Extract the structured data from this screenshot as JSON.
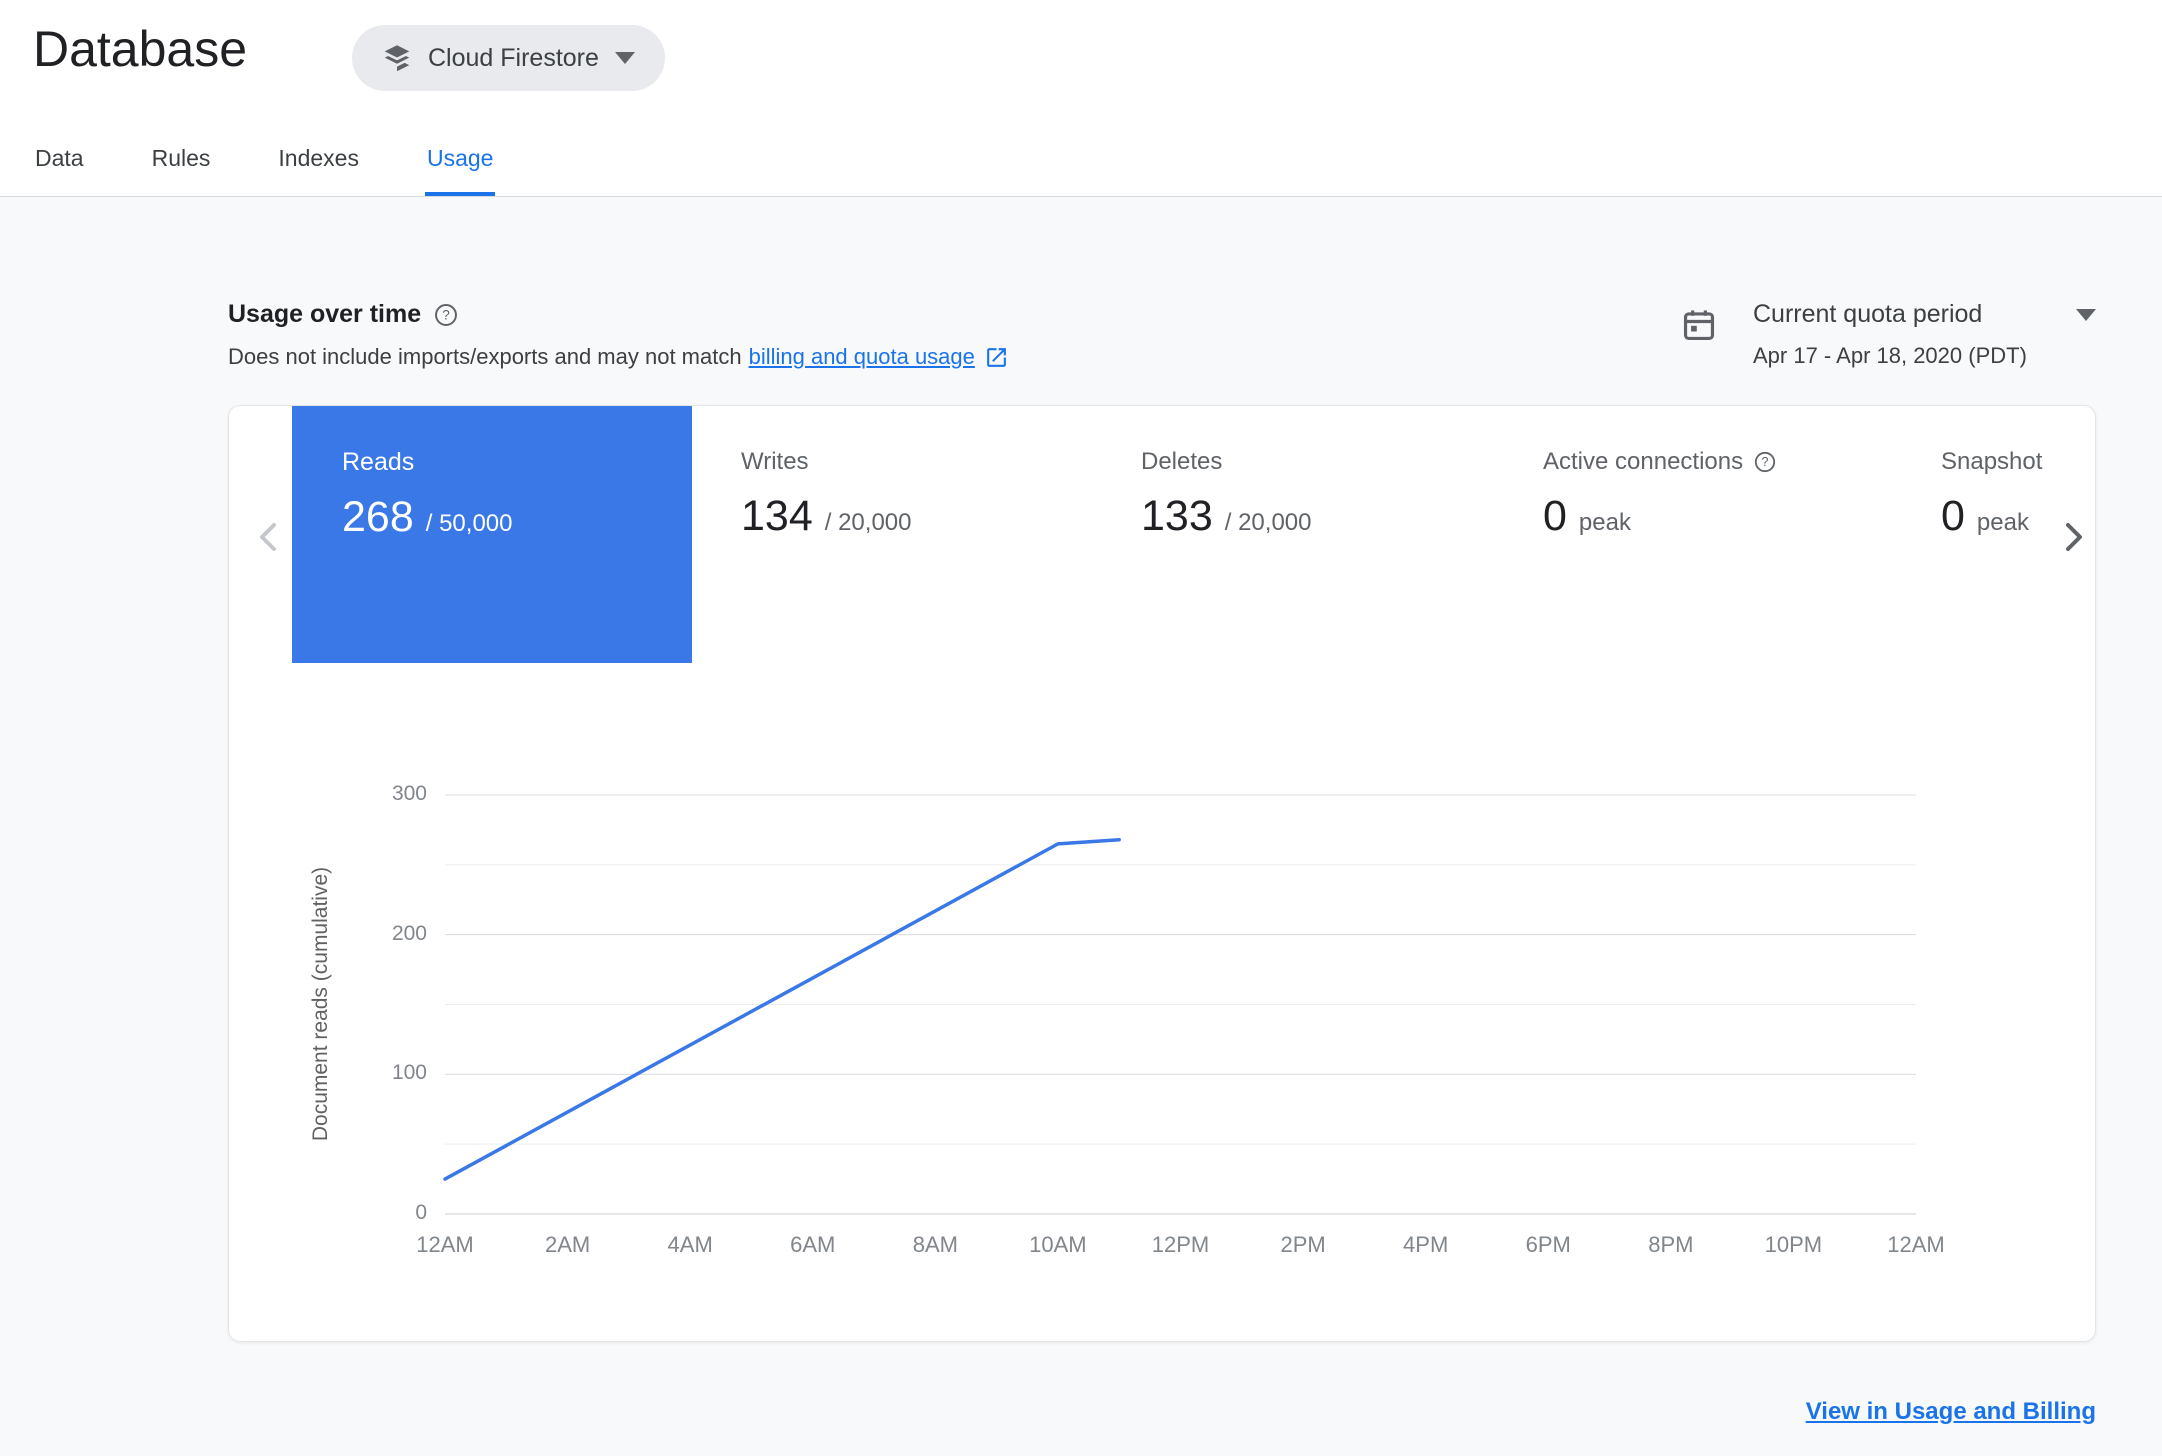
{
  "header": {
    "title": "Database",
    "product_selector": {
      "label": "Cloud Firestore"
    },
    "tabs": [
      {
        "label": "Data",
        "active": false
      },
      {
        "label": "Rules",
        "active": false
      },
      {
        "label": "Indexes",
        "active": false
      },
      {
        "label": "Usage",
        "active": true
      }
    ]
  },
  "usage_section": {
    "heading": "Usage over time",
    "subtitle_prefix": "Does not include imports/exports and may not match",
    "subtitle_link_text": "billing and quota usage",
    "quota_period": {
      "label": "Current quota period",
      "date_range": "Apr 17 - Apr 18, 2020 (PDT)"
    }
  },
  "metrics": [
    {
      "label": "Reads",
      "value": "268",
      "denominator": "/ 50,000",
      "selected": true
    },
    {
      "label": "Writes",
      "value": "134",
      "denominator": "/ 20,000",
      "selected": false
    },
    {
      "label": "Deletes",
      "value": "133",
      "denominator": "/ 20,000",
      "selected": false
    },
    {
      "label": "Active connections",
      "value": "0",
      "denominator": "peak",
      "selected": false,
      "has_help": true
    },
    {
      "label": "Snapshot listeners",
      "value": "0",
      "denominator": "peak",
      "selected": false
    }
  ],
  "chart_data": {
    "type": "line",
    "title": "",
    "ylabel": "Document reads (cumulative)",
    "xlabel": "",
    "x_ticks": [
      "12AM",
      "2AM",
      "4AM",
      "6AM",
      "8AM",
      "10AM",
      "12PM",
      "2PM",
      "4PM",
      "6PM",
      "8PM",
      "10PM",
      "12AM"
    ],
    "x_range_hours": [
      0,
      24
    ],
    "y_ticks": [
      0,
      100,
      200,
      300
    ],
    "ylim": [
      0,
      300
    ],
    "gridline_step": 50,
    "grid": true,
    "legend": false,
    "series": [
      {
        "name": "Document reads (cumulative)",
        "color": "#3b78e7",
        "points_hour_value": [
          [
            0,
            25
          ],
          [
            10,
            265
          ],
          [
            11,
            268
          ]
        ]
      }
    ]
  },
  "footer": {
    "link_label": "View in Usage and Billing"
  },
  "icons": {
    "product": "firestore-icon",
    "help": "help-icon",
    "external_link": "open-in-new-icon",
    "calendar": "calendar-icon",
    "dropdown": "arrow-drop-down-icon",
    "prev": "chevron-left-icon",
    "next": "chevron-right-icon"
  },
  "colors": {
    "accent": "#1a73e8",
    "selected_tile": "#3b78e7",
    "chart_line": "#3b78e7",
    "page_bg": "#f8f9fa",
    "text_dark": "#202124",
    "text_gray": "#5f6368"
  }
}
